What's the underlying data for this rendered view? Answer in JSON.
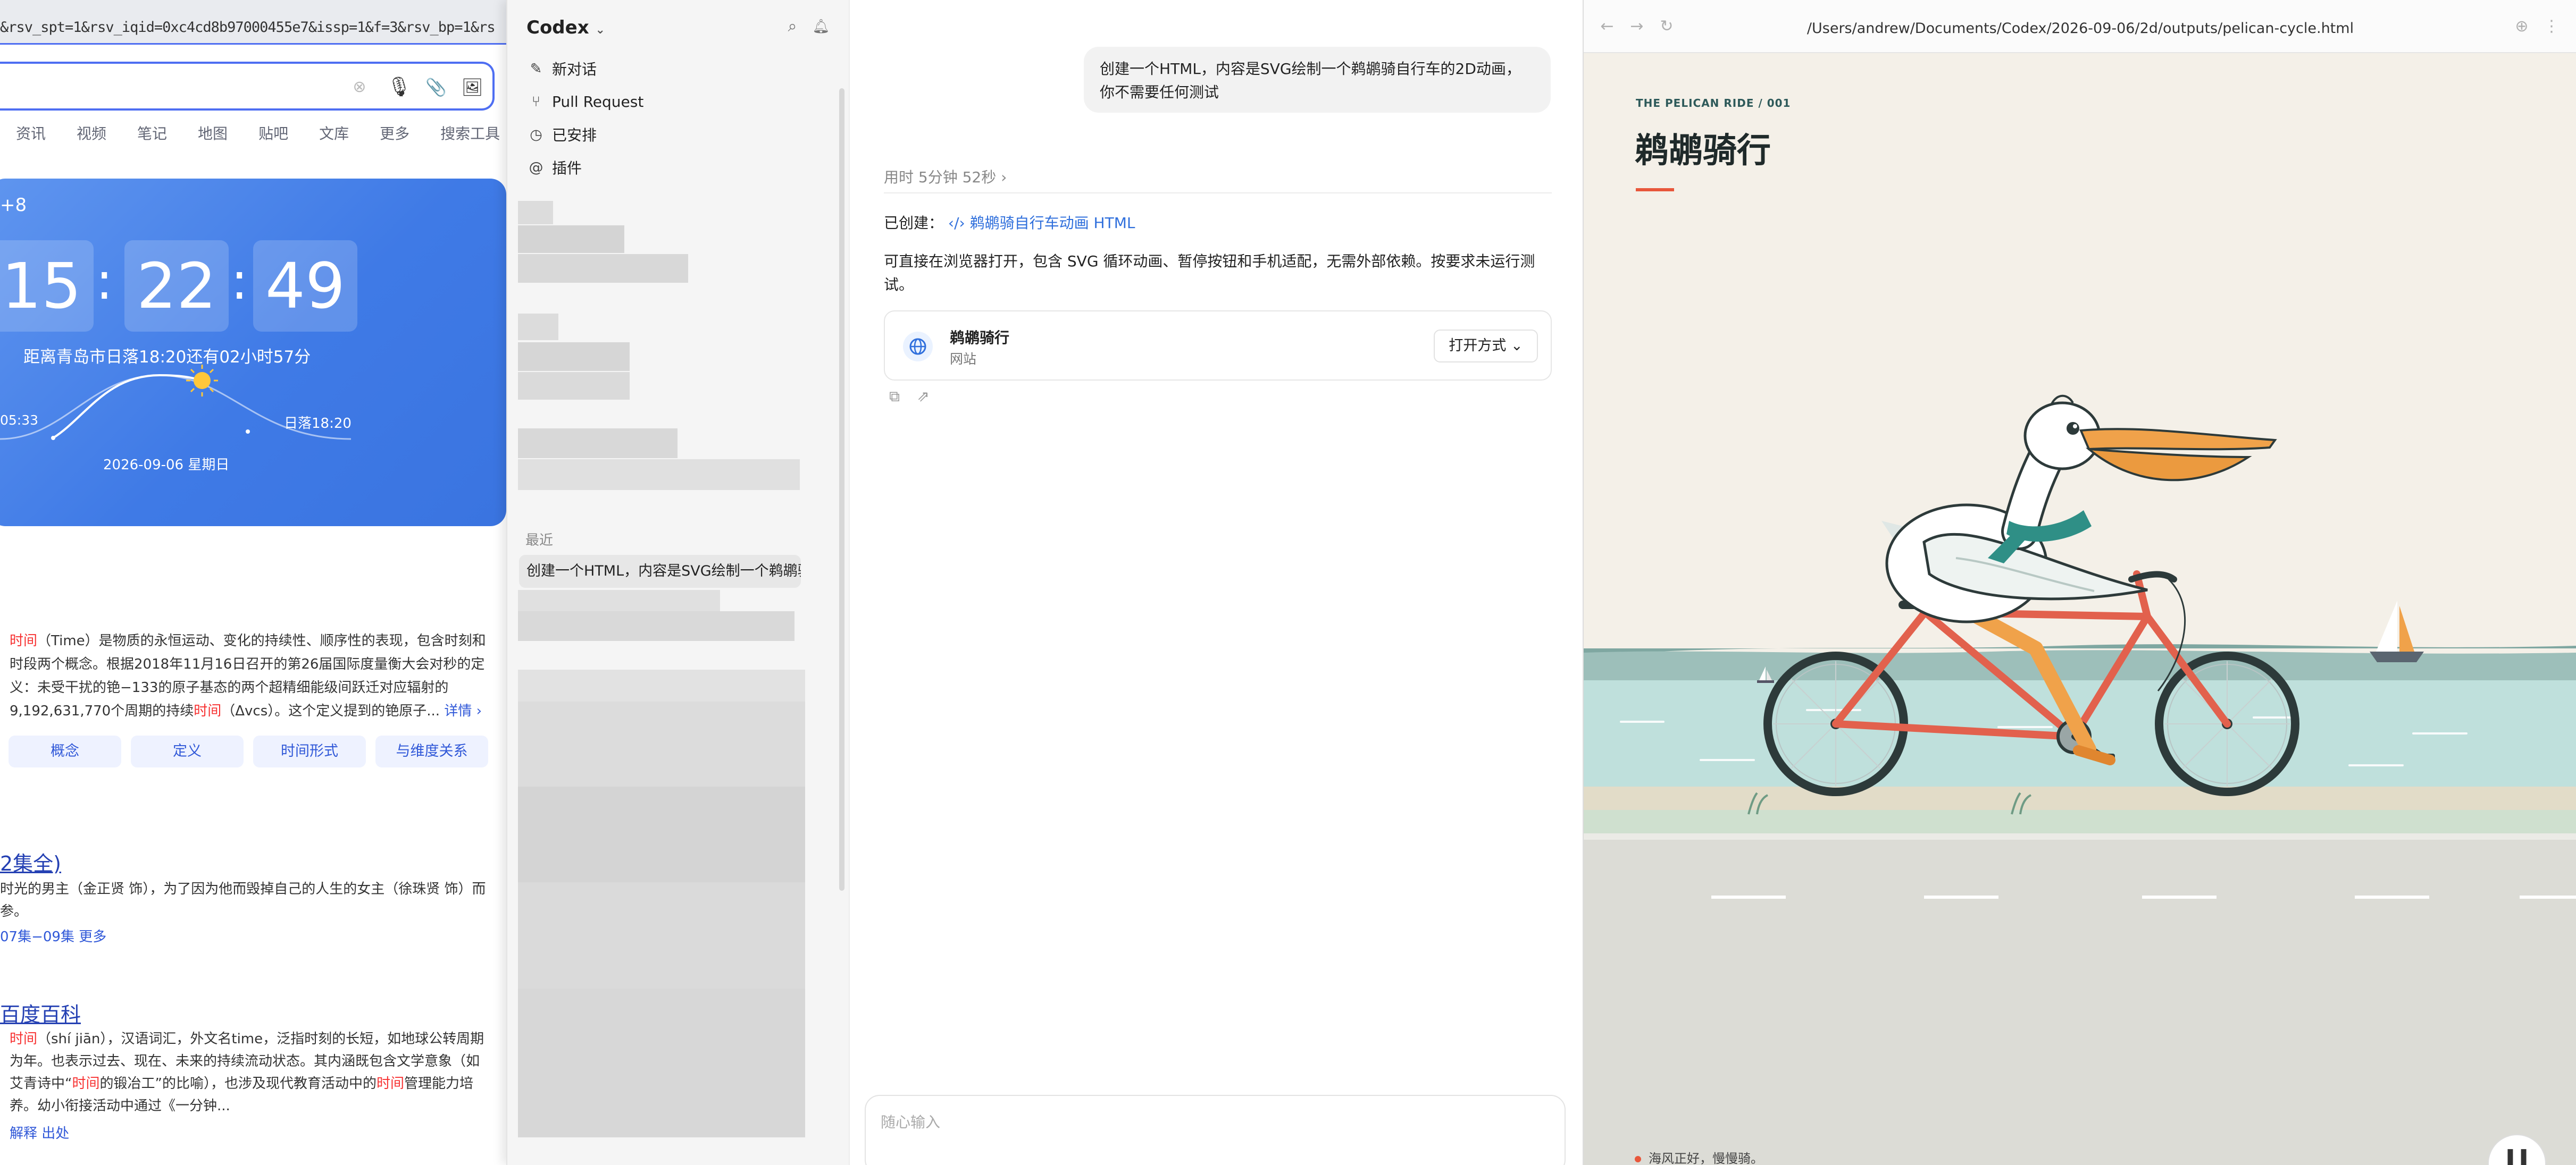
{
  "left_browser": {
    "url_fragment": "&rsv_spt=1&rsv_iqid=0xc4cd8b97000455e7&issp=1&f=3&rsv_bp=1&rs",
    "nav_tabs": [
      "资讯",
      "视频",
      "笔记",
      "地图",
      "贴吧",
      "文库",
      "更多",
      "搜索工具"
    ],
    "time_card": {
      "timezone": "+8",
      "hours": "15",
      "minutes": "22",
      "seconds": "49",
      "sunset_countdown": "距离青岛市日落18:20还有02小时57分",
      "sunrise": "05:33",
      "sunset": "日落18:20",
      "date": "2026-09-06    星期日"
    },
    "definition": {
      "lead": "时间",
      "text_1": "（Time）是物质的永恒运动、变化的持续性、顺序性的表现，包含时刻和时段两个概念。根据2018年11月16日召开的第26届国际度量衡大会对秒的定义：未受干扰的铯−133的原子基态的两个超精细能级间跃迁对应辐射的9,192,631,770个周期的持续",
      "highlight": "时间",
      "text_2": "（Δvcs）。这个定义提到的铯原子...",
      "more": "详情 ›"
    },
    "chips": [
      "概念",
      "定义",
      "时间形式",
      "与维度关系"
    ],
    "result_2": {
      "title": "2集全)",
      "desc": "时光的男主（金正贤 饰），为了因为他而毁掉自己的人生的女主（徐珠贤 饰）而",
      "desc_2": "参。",
      "links": "07集−09集   更多"
    },
    "result_3": {
      "title": "百度百科",
      "lead": "时间",
      "desc_1": "（shí jiān），汉语词汇，外文名time，泛指时刻的长短，如地球公转周期为年。也表示过去、现在、未来的持续流动状态。其内涵既包含文学意象（如艾青诗中“",
      "highlight_1": "时间",
      "desc_2": "的锻冶工”的比喻），也涉及现代教育活动中的",
      "highlight_2": "时间",
      "desc_3": "管理能力培养。幼小衔接活动中通过《一分钟...",
      "links": "解释    出处"
    }
  },
  "codex_sidebar": {
    "app_name": "Codex",
    "items": [
      {
        "icon": "new-chat-icon",
        "label": "新对话"
      },
      {
        "icon": "pull-request-icon",
        "label": "Pull Request"
      },
      {
        "icon": "schedule-icon",
        "label": "已安排"
      },
      {
        "icon": "plugin-icon",
        "label": "插件"
      }
    ],
    "recent_header": "最近",
    "recent_item": "创建一个HTML，内容是SVG绘制一个鹈鹕骑"
  },
  "chat": {
    "user_message": "创建一个HTML，内容是SVG绘制一个鹈鹕骑自行车的2D动画，你不需要任何测试",
    "elapsed": "用时 5分钟 52秒 ›",
    "created_label": "已创建：",
    "created_link": "‹/› 鹈鹕骑自行车动画 HTML",
    "response": "可直接在浏览器打开，包含 SVG 循环动画、暂停按钮和手机适配，无需外部依赖。按要求未运行测试。",
    "card_title": "鹈鹕骑行",
    "card_subtitle": "网站",
    "open_button": "打开方式 ⌄",
    "input_placeholder": "随心输入"
  },
  "preview": {
    "path": "/Users/andrew/Documents/Codex/2026-09-06/2d/outputs/pelican-cycle.html",
    "kicker": "THE PELICAN RIDE / 001",
    "title": "鹈鹕骑行",
    "status": "海风正好，慢慢骑。",
    "colors": {
      "accent": "#e8573b",
      "sky": "#f4f0e8",
      "sea": "#bfe0dc",
      "hills": "#7fa7a1",
      "road": "#dcdcd6",
      "frame": "#e2614d",
      "beak": "#f0a24a",
      "scarf": "#2f8f86"
    }
  }
}
